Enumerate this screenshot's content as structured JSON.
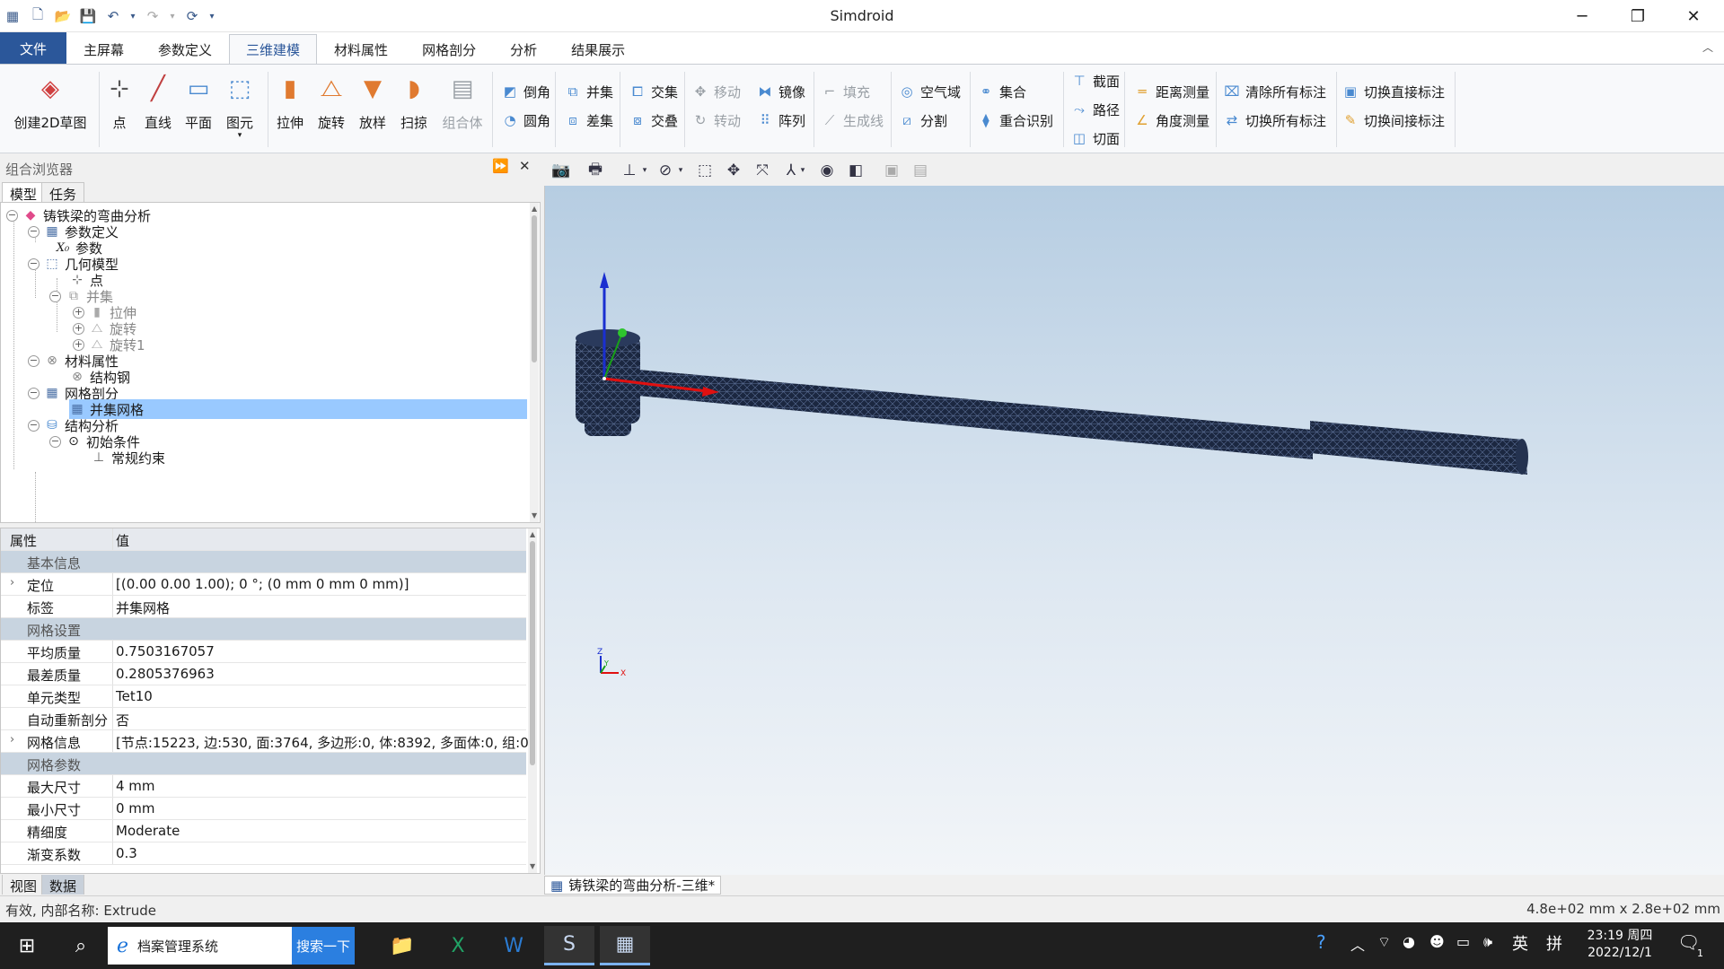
{
  "window": {
    "title": "Simdroid"
  },
  "menu": {
    "tabs": [
      "文件",
      "主屏幕",
      "参数定义",
      "三维建模",
      "材料属性",
      "网格剖分",
      "分析",
      "结果展示"
    ],
    "active": "三维建模"
  },
  "ribbon": {
    "sketch": "创建2D草图",
    "point": "点",
    "line": "直线",
    "plane": "平面",
    "primitive": "图元",
    "extrude": "拉伸",
    "revolve": "旋转",
    "loft": "放样",
    "sweep": "扫掠",
    "compound": "组合体",
    "chamfer": "倒角",
    "fillet": "圆角",
    "union": "并集",
    "subtract": "差集",
    "intersect": "交集",
    "cross": "交叠",
    "move": "移动",
    "rotate": "转动",
    "mirror": "镜像",
    "array": "阵列",
    "fill": "填充",
    "gen_line": "生成线",
    "air_domain": "空气域",
    "split": "分割",
    "assembly": "集合",
    "overlap": "重合识别",
    "section": "截面",
    "path": "路径",
    "cut_face": "切面",
    "dist_measure": "距离测量",
    "angle_measure": "角度测量",
    "clear_marks": "清除所有标注",
    "toggle_marks": "切换所有标注",
    "toggle_direct": "切换直接标注",
    "toggle_indirect": "切换间接标注"
  },
  "browser": {
    "title": "组合浏览器",
    "tabs": [
      "模型",
      "任务"
    ],
    "tree": [
      {
        "label": "铸铁梁的弯曲分析"
      },
      {
        "label": "参数定义"
      },
      {
        "label": "参数"
      },
      {
        "label": "几何模型"
      },
      {
        "label": "点"
      },
      {
        "label": "并集"
      },
      {
        "label": "拉伸"
      },
      {
        "label": "旋转"
      },
      {
        "label": "旋转1"
      },
      {
        "label": "材料属性"
      },
      {
        "label": "结构钢"
      },
      {
        "label": "网格剖分"
      },
      {
        "label": "并集网格"
      },
      {
        "label": "结构分析"
      },
      {
        "label": "初始条件"
      },
      {
        "label": "常规约束"
      }
    ]
  },
  "props": {
    "col_key": "属性",
    "col_val": "值",
    "rows": [
      {
        "k": "基本信息",
        "v": ""
      },
      {
        "k": "定位",
        "v": "[(0.00 0.00 1.00); 0 °; (0 mm  0 mm  0 mm)]"
      },
      {
        "k": "标签",
        "v": "并集网格"
      },
      {
        "k": "网格设置",
        "v": ""
      },
      {
        "k": "平均质量",
        "v": "0.7503167057"
      },
      {
        "k": "最差质量",
        "v": "0.2805376963"
      },
      {
        "k": "单元类型",
        "v": "Tet10"
      },
      {
        "k": "自动重新剖分",
        "v": "否"
      },
      {
        "k": "网格信息",
        "v": "[节点:15223, 边:530, 面:3764, 多边形:0, 体:8392, 多面体:0, 组:0]"
      },
      {
        "k": "网格参数",
        "v": ""
      },
      {
        "k": "最大尺寸",
        "v": "4 mm"
      },
      {
        "k": "最小尺寸",
        "v": "0 mm"
      },
      {
        "k": "精细度",
        "v": "Moderate"
      },
      {
        "k": "渐变系数",
        "v": "0.3"
      }
    ],
    "bottom_tabs": [
      "视图",
      "数据"
    ]
  },
  "viewport": {
    "doc_tab": "铸铁梁的弯曲分析-三维*",
    "mesh_color": "#1e2c46",
    "triad": {
      "z": "Z",
      "y": "Y",
      "x": "X"
    }
  },
  "status": {
    "left": "有效, 内部名称: Extrude",
    "right": "4.8e+02 mm x 2.8e+02 mm"
  },
  "taskbar": {
    "ie_label": "档案管理系统",
    "search_btn": "搜索一下",
    "ime1": "英",
    "ime2": "拼",
    "time": "23:19 周四",
    "date": "2022/12/1",
    "notif": "1"
  }
}
